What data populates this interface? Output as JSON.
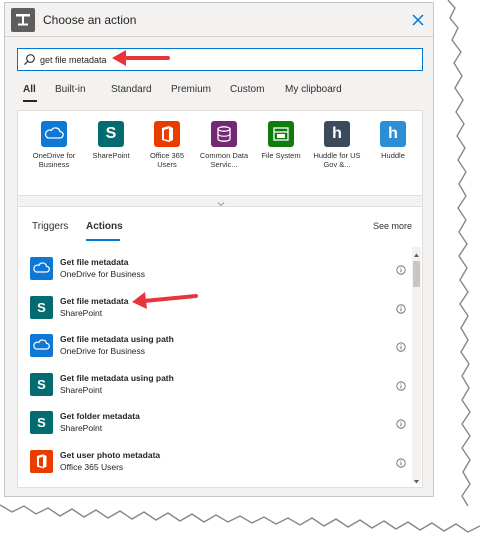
{
  "window": {
    "title": "Choose an action",
    "close_icon": "close-icon",
    "header_icon": "action-icon"
  },
  "search": {
    "value": "get file metadata",
    "placeholder": ""
  },
  "category_tabs": [
    {
      "label": "All",
      "active": true
    },
    {
      "label": "Built-in"
    },
    {
      "label": "Standard"
    },
    {
      "label": "Premium"
    },
    {
      "label": "Custom"
    },
    {
      "label": "My clipboard"
    }
  ],
  "connectors": [
    {
      "label": "OneDrive for Business",
      "icon": "onedrive-icon",
      "color": "#0f78d4"
    },
    {
      "label": "SharePoint",
      "icon": "sharepoint-icon",
      "color": "#036c70"
    },
    {
      "label": "Office 365 Users",
      "icon": "office365-icon",
      "color": "#eb3c00"
    },
    {
      "label": "Common Data Servic...",
      "icon": "database-icon",
      "color": "#742774"
    },
    {
      "label": "File System",
      "icon": "file-system-icon",
      "color": "#107c10"
    },
    {
      "label": "Huddle for US Gov &...",
      "icon": "huddle-icon",
      "color": "#3b4b5c"
    },
    {
      "label": "Huddle",
      "icon": "huddle-icon",
      "color": "#2c8fd6"
    }
  ],
  "results_tabs": [
    {
      "label": "Triggers"
    },
    {
      "label": "Actions",
      "active": true
    }
  ],
  "see_more": "See more",
  "actions": [
    {
      "title": "Get file metadata",
      "connector": "OneDrive for Business",
      "icon": "onedrive-icon",
      "color": "#0f78d4"
    },
    {
      "title": "Get file metadata",
      "connector": "SharePoint",
      "icon": "sharepoint-icon",
      "color": "#036c70"
    },
    {
      "title": "Get file metadata using path",
      "connector": "OneDrive for Business",
      "icon": "onedrive-icon",
      "color": "#0f78d4"
    },
    {
      "title": "Get file metadata using path",
      "connector": "SharePoint",
      "icon": "sharepoint-icon",
      "color": "#036c70"
    },
    {
      "title": "Get folder metadata",
      "connector": "SharePoint",
      "icon": "sharepoint-icon",
      "color": "#036c70"
    },
    {
      "title": "Get user photo metadata",
      "connector": "Office 365 Users",
      "icon": "office365-icon",
      "color": "#eb3c00"
    }
  ],
  "annotation_color": "#e8353b"
}
